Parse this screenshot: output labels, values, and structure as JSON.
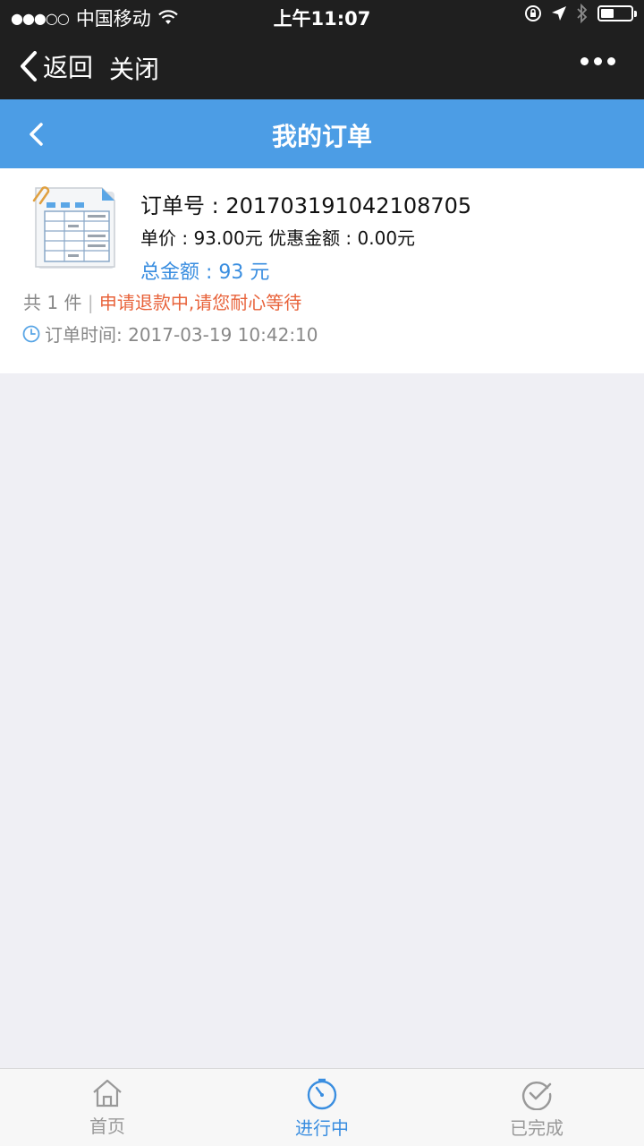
{
  "status_bar": {
    "signal": "●●●○○",
    "carrier": "中国移动",
    "time": "上午11:07"
  },
  "browser_nav": {
    "back_label": "返回",
    "close_label": "关闭"
  },
  "header": {
    "title": "我的订单"
  },
  "order": {
    "order_no": "订单号 : 201703191042108705",
    "price_line": "单价 : 93.00元  优惠金额 : 0.00元",
    "total": "总金额 : 93 元",
    "count": "共 1 件",
    "separator": "|",
    "status": "申请退款中,请您耐心等待",
    "time": "订单时间: 2017-03-19 10:42:10"
  },
  "tabs": [
    {
      "label": "首页",
      "icon": "home-icon"
    },
    {
      "label": "进行中",
      "icon": "timer-icon"
    },
    {
      "label": "已完成",
      "icon": "check-circle-icon"
    }
  ],
  "colors": {
    "header_bg": "#4c9de5",
    "status_text": "#e8623a",
    "total_text": "#3a8ee0",
    "active_tab": "#3a8ee0"
  }
}
